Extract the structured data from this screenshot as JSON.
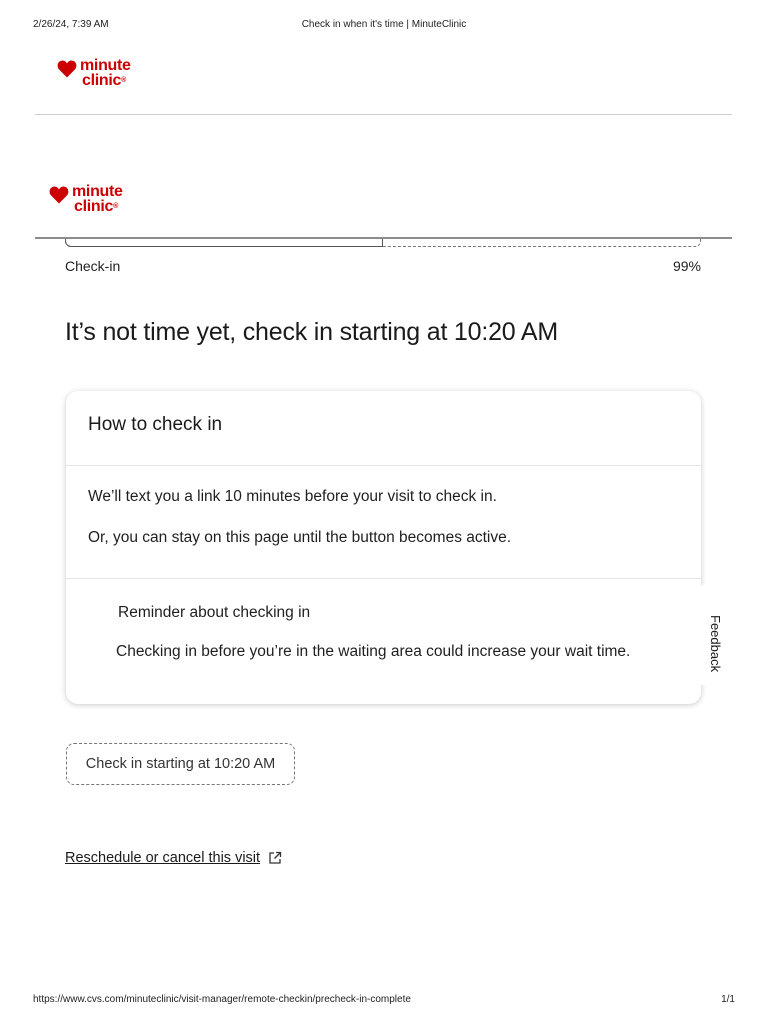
{
  "print_header": {
    "datetime": "2/26/24, 7:39 AM",
    "title": "Check in when it's time | MinuteClinic"
  },
  "brand": {
    "line1": "minute",
    "line2": "clinic",
    "trademark": "®",
    "color": "#cc0000",
    "icon": "heart-icon"
  },
  "progress": {
    "step_label": "Check-in",
    "percent_label": "99%",
    "value": 0.5
  },
  "headline": "It’s not time yet, check in starting at 10:20 AM",
  "card": {
    "title": "How to check in",
    "body": [
      "We’ll text you a link 10 minutes before your visit to check in.",
      "Or, you can stay on this page until the button becomes active."
    ],
    "reminder_title": "Reminder about checking in",
    "reminder_text": "Checking in before you’re in the waiting area could increase your wait time."
  },
  "feedback_label": "Feedback",
  "checkin_button_label": "Check in starting at 10:20 AM",
  "reschedule_link": {
    "label": "Reschedule or cancel this visit",
    "icon": "external-link-icon"
  },
  "print_footer": {
    "url": "https://www.cvs.com/minuteclinic/visit-manager/remote-checkin/precheck-in-complete",
    "page": "1/1"
  }
}
